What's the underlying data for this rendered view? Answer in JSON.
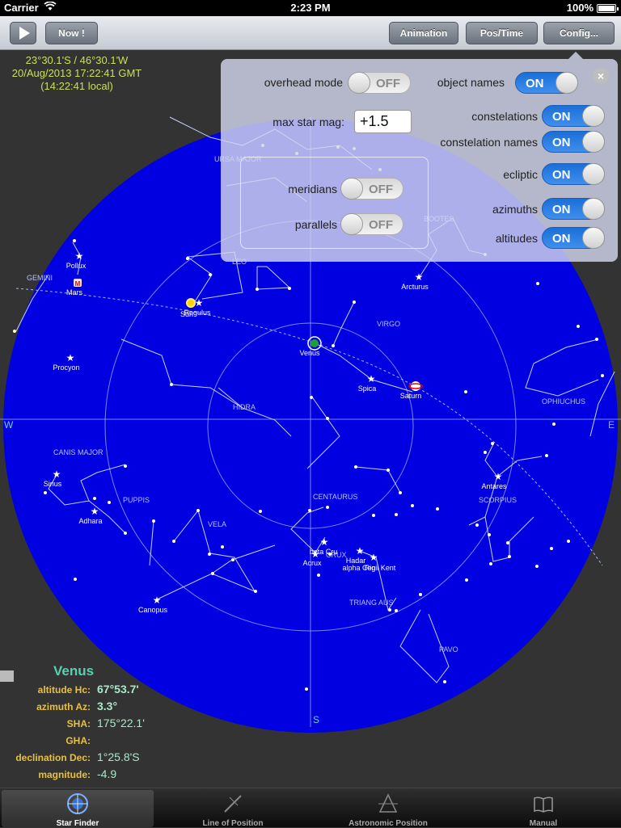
{
  "status": {
    "carrier": "Carrier",
    "time": "2:23 PM",
    "battery": "100%"
  },
  "toolbar": {
    "now_label": "Now !",
    "animation_label": "Animation",
    "postime_label": "Pos/Time",
    "config_label": "Config..."
  },
  "location": {
    "coords": "23°30.1'S / 46°30.1'W",
    "gmt": "20/Aug/2013 17:22:41 GMT",
    "local": "(14:22:41 local)"
  },
  "sky": {
    "cardinals": {
      "west": "W",
      "east": "E",
      "south": "S"
    },
    "stars": [
      {
        "name": "Pollux"
      },
      {
        "name": "Regulus"
      },
      {
        "name": "Procyon"
      },
      {
        "name": "Sirius"
      },
      {
        "name": "Adhara"
      },
      {
        "name": "Canopus"
      },
      {
        "name": "Arcturus"
      },
      {
        "name": "Spica"
      },
      {
        "name": "Antares"
      },
      {
        "name": "Acrux"
      },
      {
        "name": "beta Cru"
      },
      {
        "name": "Hadar"
      },
      {
        "name": "alpha Cen"
      },
      {
        "name": "Rigil Kent"
      }
    ],
    "planets": [
      {
        "name": "Mars"
      },
      {
        "name": "Sun"
      },
      {
        "name": "Venus"
      },
      {
        "name": "Saturn"
      }
    ],
    "constellations": [
      "GEMINI",
      "LEO",
      "URSA MAJOR",
      "VIRGO",
      "BOOTES",
      "HIDRA",
      "CANIS MAJOR",
      "PUPPIS",
      "VELA",
      "CENTAURUS",
      "SCORPIUS",
      "OPHIUCHUS",
      "CRUX",
      "TRIANG AUS",
      "PAVO"
    ]
  },
  "config": {
    "overhead_mode": {
      "label": "overhead mode",
      "state": "OFF"
    },
    "object_names": {
      "label": "object names",
      "state": "ON"
    },
    "max_star_mag": {
      "label": "max star mag:",
      "value": "+1.5"
    },
    "meridians": {
      "label": "meridians",
      "state": "OFF"
    },
    "parallels": {
      "label": "parallels",
      "state": "OFF"
    },
    "constelations": {
      "label": "constelations",
      "state": "ON"
    },
    "constelation_names": {
      "label": "constelation names",
      "state": "ON"
    },
    "ecliptic": {
      "label": "ecliptic",
      "state": "ON"
    },
    "azimuths": {
      "label": "azimuths",
      "state": "ON"
    },
    "altitudes": {
      "label": "altitudes",
      "state": "ON"
    },
    "close": "×"
  },
  "info": {
    "object": "Venus",
    "rows": [
      {
        "label": "altitude Hc:",
        "value": "67°53.7'"
      },
      {
        "label": "azimuth Az:",
        "value": "3.3°"
      },
      {
        "label": "SHA:",
        "value": "175°22.1'"
      },
      {
        "label": "GHA:",
        "value": ""
      },
      {
        "label": "declination Dec:",
        "value": "1°25.8'S"
      },
      {
        "label": "magnitude:",
        "value": "-4.9"
      }
    ]
  },
  "tabs": [
    {
      "label": "Star Finder",
      "icon": "star-finder-icon"
    },
    {
      "label": "Line of Position",
      "icon": "line-of-position-icon"
    },
    {
      "label": "Astronomic Position",
      "icon": "astronomic-position-icon"
    },
    {
      "label": "Manual",
      "icon": "manual-book-icon"
    }
  ],
  "colors": {
    "sky": "#0000e0",
    "accent_on": "#2a7fe6",
    "label_gold": "#e8c040",
    "value_green": "#a9e8c9"
  }
}
